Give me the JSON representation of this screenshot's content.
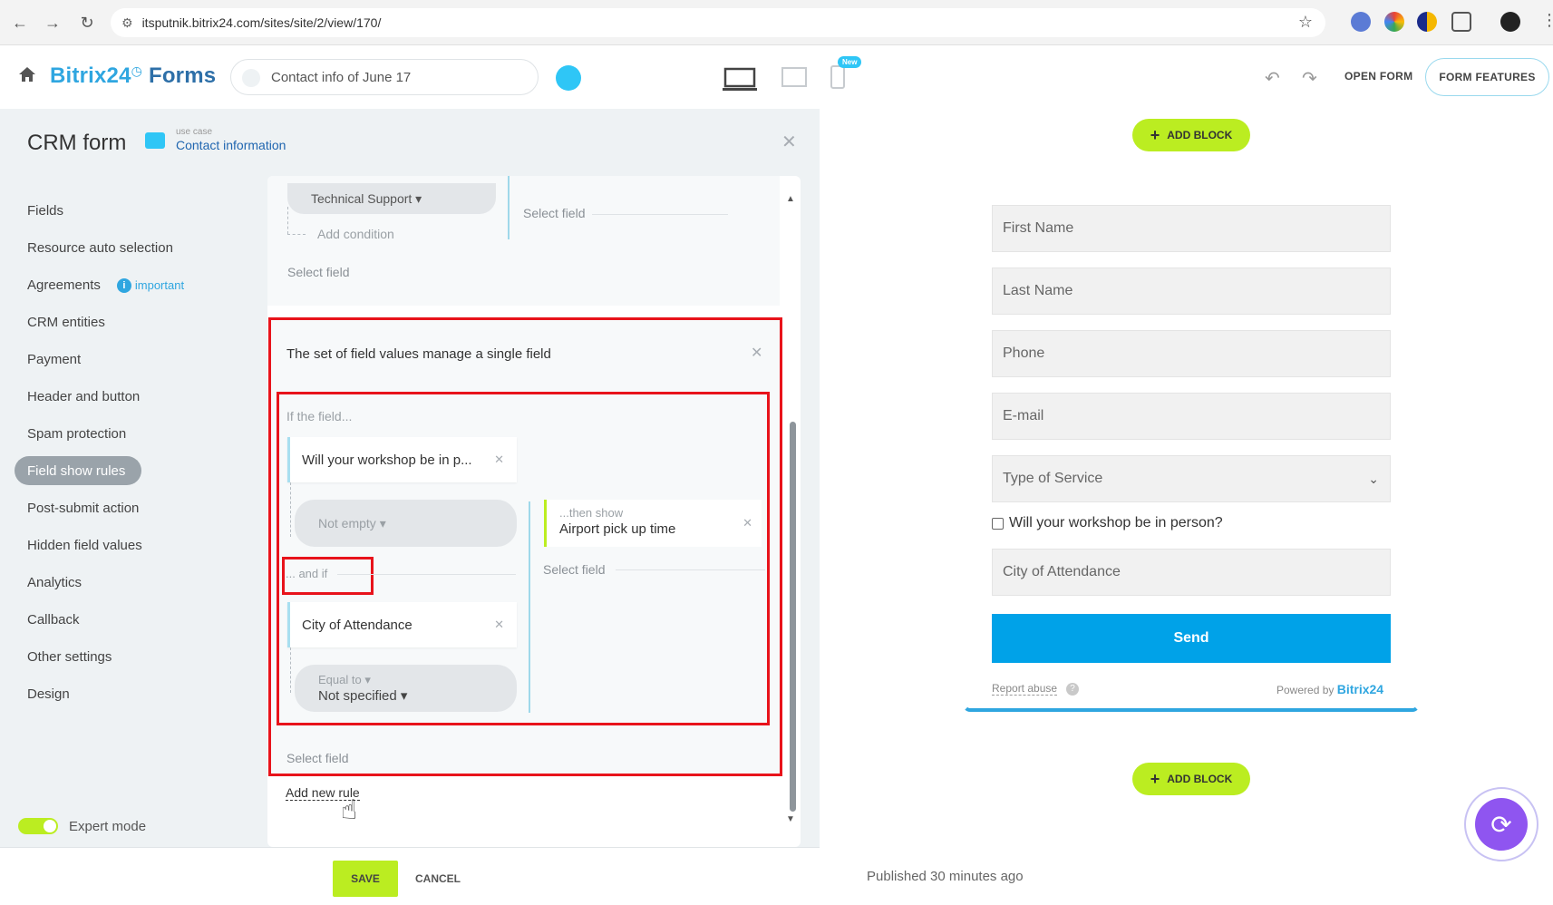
{
  "browser": {
    "url": "itsputnik.bitrix24.com/sites/site/2/view/170/"
  },
  "header": {
    "logo_text": "Bitrix24",
    "logo_forms": "Forms",
    "form_title": "Contact info of June 17",
    "new_badge": "New",
    "open_form": "OPEN FORM",
    "form_features": "FORM FEATURES"
  },
  "panel": {
    "title": "CRM form",
    "use_case_label": "use case",
    "use_case_value": "Contact information"
  },
  "nav": {
    "items": [
      {
        "label": "Fields"
      },
      {
        "label": "Resource auto selection"
      },
      {
        "label": "Agreements",
        "badge": "important"
      },
      {
        "label": "CRM entities"
      },
      {
        "label": "Payment"
      },
      {
        "label": "Header and button"
      },
      {
        "label": "Spam protection"
      },
      {
        "label": "Field show rules",
        "active": true
      },
      {
        "label": "Post-submit action"
      },
      {
        "label": "Hidden field values"
      },
      {
        "label": "Analytics"
      },
      {
        "label": "Callback"
      },
      {
        "label": "Other settings"
      },
      {
        "label": "Design"
      }
    ],
    "expert_mode": "Expert mode"
  },
  "rules": {
    "top": {
      "pill_value": "Technical Support ▾",
      "add_condition": "Add condition",
      "select_field_right": "Select field",
      "select_field_bottom": "Select field"
    },
    "rule2": {
      "title": "The set of field values manage a single field",
      "if_label": "If the field...",
      "field1": "Will your workshop be in p...",
      "op1": "Not empty ▾",
      "and_if": "... and if",
      "field2": "City of Attendance",
      "op2_label": "Equal to ▾",
      "op2_value": "Not specified ▾",
      "then_label": "...then show",
      "then_value": "Airport pick up time",
      "select_field_right": "Select field",
      "select_field_bottom": "Select field"
    },
    "add_new_rule": "Add new rule"
  },
  "footer": {
    "save": "SAVE",
    "cancel": "CANCEL"
  },
  "preview": {
    "add_block": "ADD BLOCK",
    "fields": [
      "First Name",
      "Last Name",
      "Phone",
      "E-mail",
      "Type of Service"
    ],
    "checkbox_label": "Will your workshop be in person?",
    "city_field": "City of Attendance",
    "send": "Send",
    "report_abuse": "Report abuse",
    "powered_by": "Powered by",
    "powered_brand": "Bitrix24",
    "published": "Published 30 minutes ago"
  },
  "colors": {
    "accent": "#2fc6f6",
    "lime": "#bbed21",
    "send_blue": "#00a2e8",
    "highlight_red": "#e8131b"
  }
}
